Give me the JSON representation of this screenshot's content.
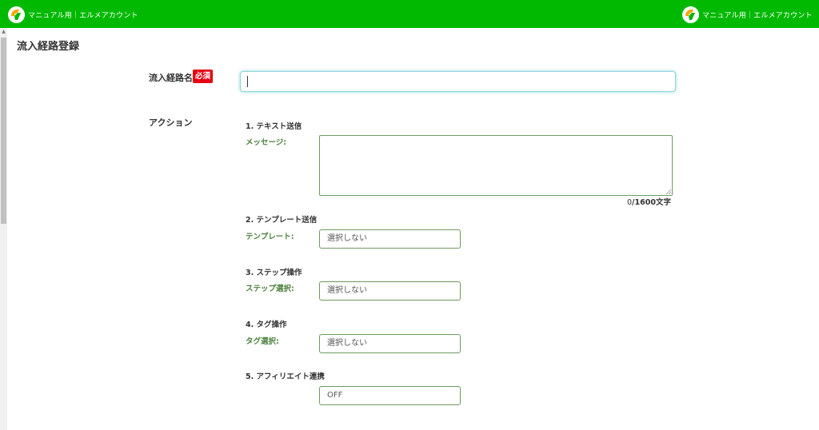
{
  "header": {
    "brand_left": "マニュアル用｜エルメアカウント",
    "brand_right": "マニュアル用｜エルメアカウント",
    "logo_icon": "lme-logo-icon",
    "bar_color": "#00b900"
  },
  "page": {
    "title": "流入経路登録"
  },
  "form": {
    "name_label": "流入経路名",
    "required_badge": "必須",
    "name_value": "",
    "action_label": "アクション",
    "sections": {
      "text": {
        "title": "1. テキスト送信",
        "field_label": "メッセージ:",
        "message_value": "",
        "counter_current": "0",
        "counter_max": "/1600文字"
      },
      "template": {
        "title": "2. テンプレート送信",
        "field_label": "テンプレート:",
        "selected": "選択しない"
      },
      "step": {
        "title": "3. ステップ操作",
        "field_label": "ステップ選択:",
        "selected": "選択しない"
      },
      "tag": {
        "title": "4. タグ操作",
        "field_label": "タグ選択:",
        "selected": "選択しない"
      },
      "affiliate": {
        "title": "5. アフィリエイト連携",
        "selected": "OFF"
      }
    }
  }
}
